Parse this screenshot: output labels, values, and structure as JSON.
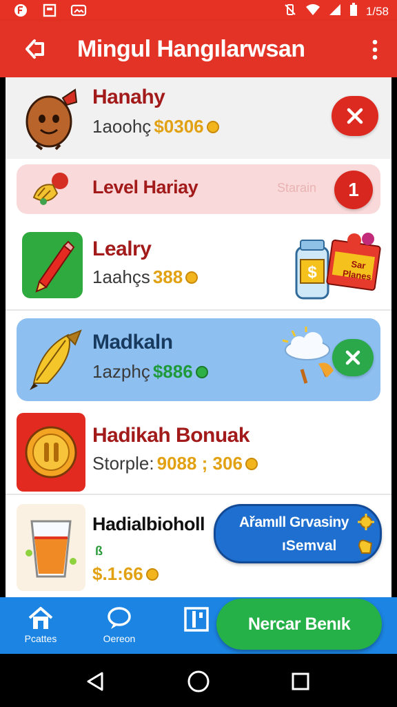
{
  "status_bar": {
    "time": "1/58"
  },
  "app_bar": {
    "title": "Mingul Hangılarwsan"
  },
  "items": [
    {
      "name": "Hanahy",
      "sub_label": "1aoohç",
      "price": "$0306"
    },
    {
      "name": "Level Hariay",
      "side_text": "Starain",
      "count": "1"
    },
    {
      "name": "Lealry",
      "sub_label": "1aahçs",
      "price": "388",
      "promo_text": "Sar Planes"
    },
    {
      "name": "Madkaln",
      "sub_label": "1azphç",
      "price": "$886"
    },
    {
      "name": "Hadikah Bonuak",
      "sub_label": "Storple:",
      "price": "9088 ; 306"
    },
    {
      "name": "Hadialbioholl",
      "sub_small": "ß",
      "price": "$.1:66",
      "promo_line1": "Ařamıll Grvasiny",
      "promo_line2": "ıSemval"
    }
  ],
  "bottom_nav": {
    "items": [
      {
        "label": "Pcattes"
      },
      {
        "label": "Oereon"
      },
      {
        "label": ""
      }
    ],
    "cta_label": "Nercar Benık"
  },
  "colors": {
    "primary_red": "#e33326",
    "nav_blue": "#1c84e2",
    "cta_green": "#26b048",
    "price_gold": "#e2a112"
  }
}
